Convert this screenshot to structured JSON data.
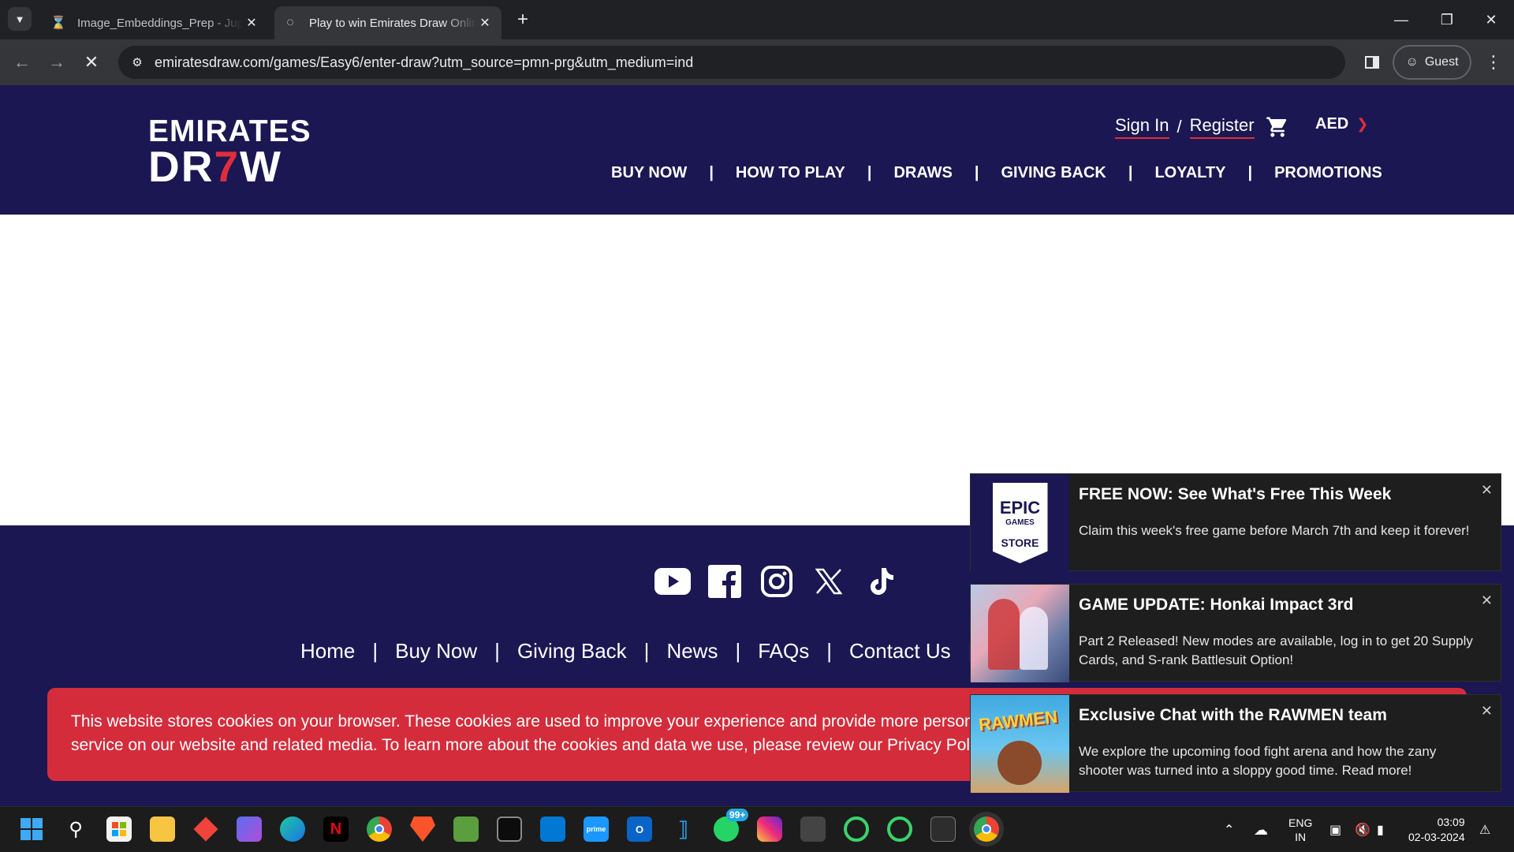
{
  "browser": {
    "tabs": [
      {
        "title": "Image_Embeddings_Prep - Jupyter",
        "active": false
      },
      {
        "title": "Play to win Emirates Draw Online",
        "active": true
      }
    ],
    "url": "emiratesdraw.com/games/Easy6/enter-draw?utm_source=pmn-prg&utm_medium=ind",
    "profile_label": "Guest"
  },
  "site": {
    "logo_line1": "EMIRATES",
    "logo_line2_a": "DR",
    "logo_line2_b": "7",
    "logo_line2_c": "W",
    "sign_in": "Sign In",
    "slash": "/",
    "register": "Register",
    "currency": "AED",
    "nav": [
      "BUY NOW",
      "HOW TO PLAY",
      "DRAWS",
      "GIVING BACK",
      "LOYALTY",
      "PROMOTIONS"
    ],
    "sep": "|"
  },
  "footer": {
    "links": [
      "Home",
      "Buy Now",
      "Giving Back",
      "News",
      "FAQs",
      "Contact Us"
    ],
    "sep": "|",
    "cookie_line1": "This website stores cookies on your browser. These cookies are used to improve your experience and provide more personalized",
    "cookie_line2": "service on our website and related media. To learn more about the cookies and data we use, please review our Privacy Policy."
  },
  "notifications": [
    {
      "title": "FREE NOW: See What's Free This Week",
      "body": "Claim this week's free game before March 7th and keep it forever!",
      "thumb_top": "EPIC",
      "thumb_mid": "GAMES",
      "thumb_bottom": "STORE"
    },
    {
      "title": "GAME UPDATE: Honkai Impact 3rd",
      "body": "Part 2 Released! New modes are available, log in to get 20 Supply Cards, and S-rank Battlesuit Option!"
    },
    {
      "title": "Exclusive Chat with the RAWMEN team",
      "body": "We explore the upcoming food fight arena and how the zany shooter was turned into a sloppy good time. Read more!",
      "thumb_text": "RAWMEN"
    }
  ],
  "taskbar": {
    "whatsapp_badge": "99+",
    "lang_line1": "ENG",
    "lang_line2": "IN",
    "time": "03:09",
    "date": "02-03-2024"
  },
  "colors": {
    "brand_navy": "#1b1752",
    "brand_red": "#e02d3c",
    "cookie_red": "#d42c3b"
  }
}
